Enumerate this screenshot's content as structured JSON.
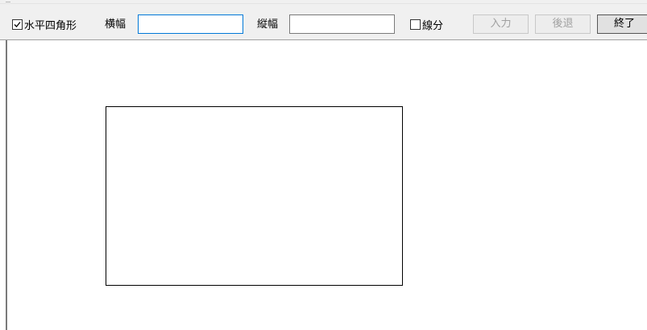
{
  "toolbar": {
    "shape_checkbox": {
      "label": "水平四角形",
      "checked": true
    },
    "width_label": "横幅",
    "width_value": "",
    "height_label": "縦幅",
    "height_value": "",
    "segment_checkbox": {
      "label": "線分",
      "checked": false
    },
    "input_button": "入力",
    "back_button": "後退",
    "end_button": "終了"
  },
  "canvas": {
    "shape": "rectangle"
  }
}
